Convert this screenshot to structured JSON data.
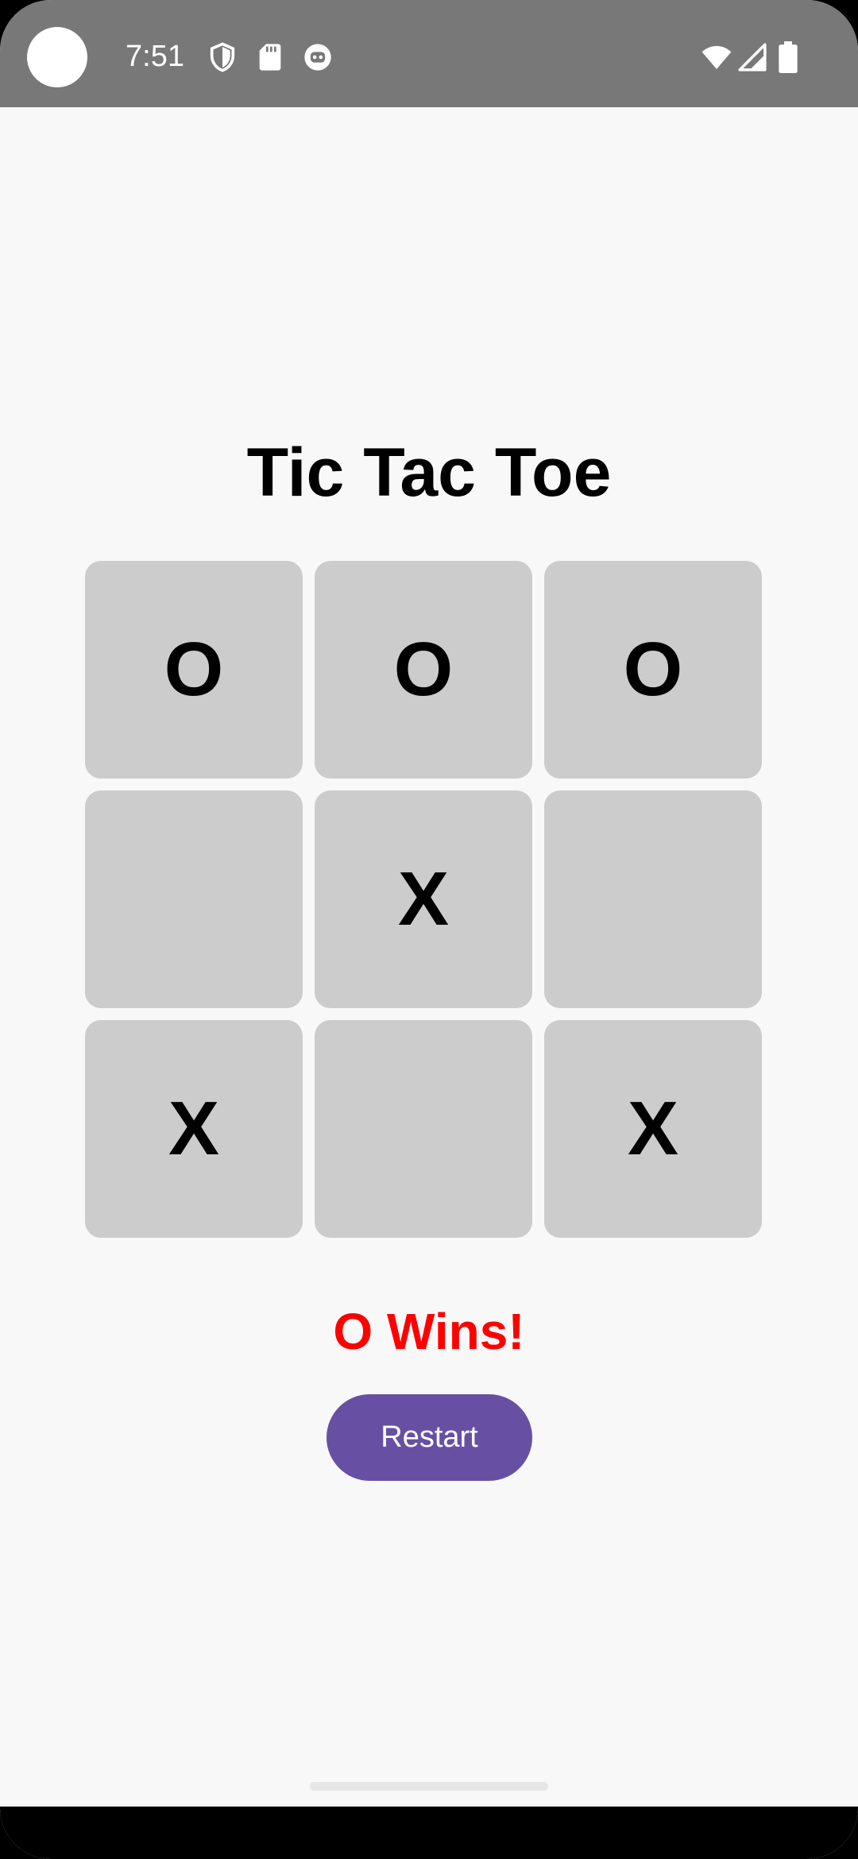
{
  "status_bar": {
    "time": "7:51",
    "icons": [
      "shield-icon",
      "sd-card-icon",
      "robot-icon",
      "wifi-icon",
      "signal-icon",
      "battery-icon"
    ]
  },
  "app": {
    "title": "Tic Tac Toe",
    "board": [
      "O",
      "O",
      "O",
      "",
      "X",
      "",
      "X",
      "",
      "X"
    ],
    "result": "O Wins!",
    "restart_label": "Restart"
  },
  "colors": {
    "status_bar": "#787878",
    "background": "#f8f8f8",
    "cell": "#cccccc",
    "result_text": "#ff0000",
    "button": "#6750a4"
  }
}
